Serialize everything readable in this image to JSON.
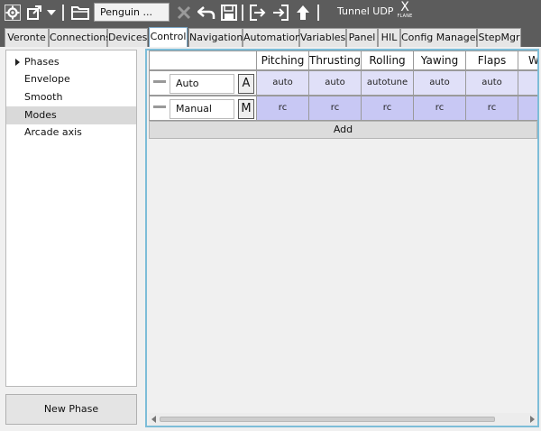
{
  "toolbar": {
    "project": "Penguin ...",
    "connection": "Tunnel UDP",
    "brand_top": "X",
    "brand_bottom": "FLANE"
  },
  "tabs": [
    "Veronte",
    "Connections",
    "Devices",
    "Control",
    "Navigation",
    "Automation",
    "Variables",
    "Panel",
    "HIL",
    "Config Manager",
    "StepMgr"
  ],
  "active_tab": "Control",
  "sidebar": {
    "items": [
      {
        "label": "Phases",
        "expandable": true
      },
      {
        "label": "Envelope"
      },
      {
        "label": "Smooth"
      },
      {
        "label": "Modes",
        "selected": true
      },
      {
        "label": "Arcade axis"
      }
    ],
    "new_phase_label": "New Phase"
  },
  "modes_grid": {
    "columns": [
      "Pitching",
      "Thrusting",
      "Rolling",
      "Yawing",
      "Flaps",
      "W"
    ],
    "rows": [
      {
        "name": "Auto",
        "key": "A",
        "values": [
          "auto",
          "auto",
          "autotune",
          "auto",
          "auto",
          ""
        ]
      },
      {
        "name": "Manual",
        "key": "M",
        "values": [
          "rc",
          "rc",
          "rc",
          "rc",
          "rc",
          ""
        ]
      }
    ],
    "add_label": "Add"
  },
  "colors": {
    "toolbar_bg": "#5c5c5c",
    "auto_row": "#e0e0f8",
    "manual_row": "#c8c8f4",
    "focus_border": "#7dbdd8"
  }
}
